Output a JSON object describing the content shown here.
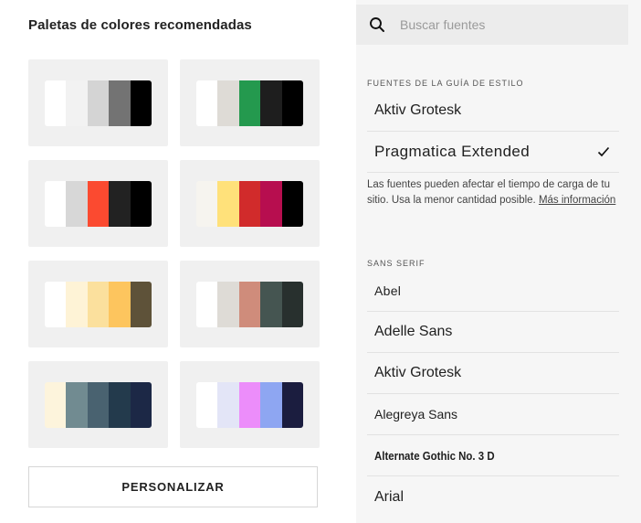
{
  "left_panel": {
    "title": "Paletas de colores recomendadas",
    "palettes": [
      {
        "colors": [
          "#ffffff",
          "#f2f2f2",
          "#d4d4d4",
          "#737373",
          "#000000"
        ]
      },
      {
        "colors": [
          "#ffffff",
          "#dedbd6",
          "#24994e",
          "#1e1e1e",
          "#000000"
        ]
      },
      {
        "colors": [
          "#ffffff",
          "#d7d7d7",
          "#fb4a30",
          "#222222",
          "#000000"
        ]
      },
      {
        "colors": [
          "#f6f4ef",
          "#ffe17a",
          "#d12b2b",
          "#b70e4f",
          "#000000"
        ]
      },
      {
        "colors": [
          "#ffffff",
          "#fef3d6",
          "#fbe09d",
          "#fdc55e",
          "#5e5239"
        ]
      },
      {
        "colors": [
          "#ffffff",
          "#dedbd6",
          "#cf8c7b",
          "#455551",
          "#28302e"
        ]
      },
      {
        "colors": [
          "#fdf4dc",
          "#718b91",
          "#496270",
          "#233a4c",
          "#1c2846"
        ]
      },
      {
        "colors": [
          "#ffffff",
          "#e3e5f7",
          "#ec8dfa",
          "#8ea6f2",
          "#1b1d3f"
        ]
      }
    ],
    "customize_label": "PERSONALIZAR"
  },
  "right_panel": {
    "search": {
      "placeholder": "Buscar fuentes",
      "icon": "search-icon"
    },
    "style_guide": {
      "label": "FUENTES DE LA GUÍA DE ESTILO",
      "fonts": [
        {
          "name": "Aktiv Grotesk",
          "selected": false
        },
        {
          "name": "Pragmatica Extended",
          "selected": true
        }
      ]
    },
    "note": {
      "text": "Las fuentes pueden afectar el tiempo de carga de tu sitio. Usa la menor cantidad posible. ",
      "link": "Más información"
    },
    "sans_serif": {
      "label": "SANS SERIF",
      "fonts": [
        {
          "name": "Abel"
        },
        {
          "name": "Adelle Sans"
        },
        {
          "name": "Aktiv Grotesk"
        },
        {
          "name": "Alegreya Sans"
        },
        {
          "name": "Alternate Gothic No. 3 D"
        },
        {
          "name": "Arial"
        }
      ]
    }
  }
}
